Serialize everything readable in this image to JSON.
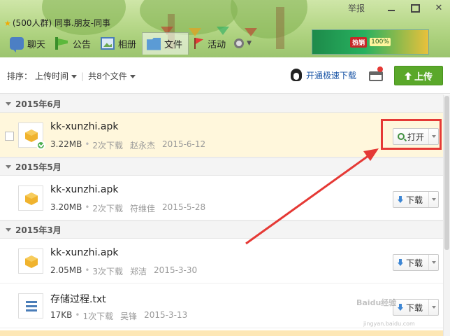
{
  "window": {
    "group_title": "(500人群) 同事.朋友-同事",
    "hint": "举报"
  },
  "tabs": [
    {
      "label": "聊天",
      "icon": "chat-icon"
    },
    {
      "label": "公告",
      "icon": "notice-flag-icon"
    },
    {
      "label": "相册",
      "icon": "album-icon"
    },
    {
      "label": "文件",
      "icon": "folder-icon",
      "active": true
    },
    {
      "label": "活动",
      "icon": "event-flag-icon"
    }
  ],
  "ad": {
    "label": "热销",
    "tag": "100%"
  },
  "toolbar": {
    "sort_label": "排序：",
    "sort_value": "上传时间",
    "count_label": "共8个文件",
    "speed_label": "开通极速下载",
    "upload_label": "上传"
  },
  "sections": [
    {
      "title": "2015年6月",
      "files": [
        {
          "name": "kk-xunzhi.apk",
          "size": "3.22MB",
          "downloads": "2次下载",
          "uploader": "赵永杰",
          "date": "2015-6-12",
          "action": "打开",
          "type": "apk",
          "selected": true
        }
      ]
    },
    {
      "title": "2015年5月",
      "files": [
        {
          "name": "kk-xunzhi.apk",
          "size": "3.20MB",
          "downloads": "2次下载",
          "uploader": "符维佳",
          "date": "2015-5-28",
          "action": "下载",
          "type": "apk"
        }
      ]
    },
    {
      "title": "2015年3月",
      "files": [
        {
          "name": "kk-xunzhi.apk",
          "size": "2.05MB",
          "downloads": "3次下载",
          "uploader": "郑洁",
          "date": "2015-3-30",
          "action": "下载",
          "type": "apk"
        },
        {
          "name": "存储过程.txt",
          "size": "17KB",
          "downloads": "1次下载",
          "uploader": "吴锋",
          "date": "2015-3-13",
          "action": "下载",
          "type": "txt"
        }
      ]
    }
  ],
  "watermark": {
    "text": "Baidu经验",
    "url": "jingyan.baidu.com"
  },
  "colors": {
    "accent_green": "#5aa82a",
    "highlight_red": "#e53935",
    "link_blue": "#1a55a6"
  }
}
